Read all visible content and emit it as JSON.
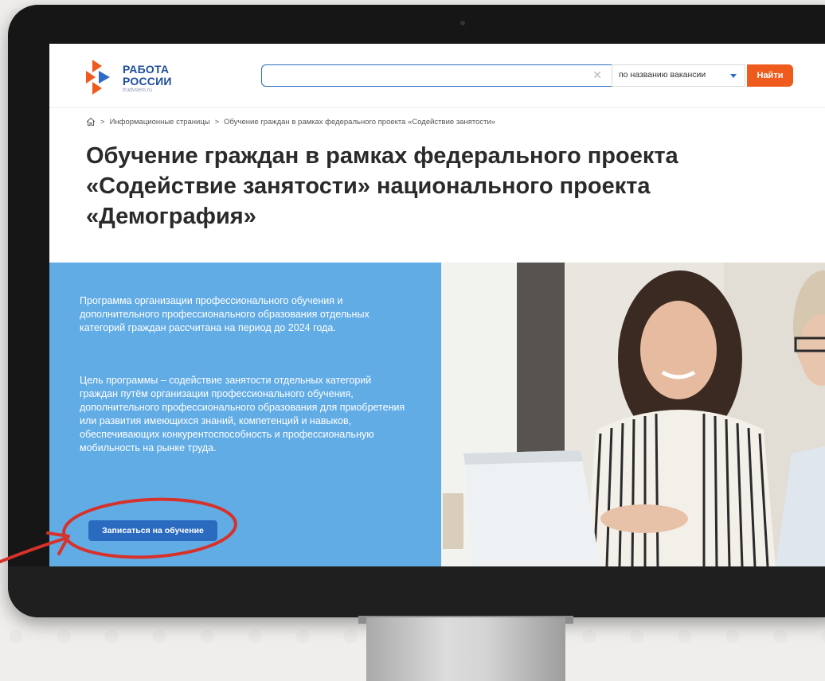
{
  "header": {
    "logo_line1": "РАБОТА",
    "logo_line2": "РОССИИ",
    "logo_site": "trudvsem.ru",
    "search_placeholder": "",
    "search_type": "по названию вакансии",
    "find_label": "Найти"
  },
  "breadcrumb": {
    "separator": ">",
    "items": [
      "Информационные страницы",
      "Обучение граждан в рамках федерального проекта «Содействие занятости»"
    ]
  },
  "page": {
    "title": "Обучение граждан в рамках федерального проекта «Содействие занятости» национального проекта «Демография»"
  },
  "panel": {
    "paragraph1": "Программа организации профессионального обучения и дополнительного профессионального образования отдельных категорий граждан рассчитана на период до 2024 года.",
    "paragraph2": "Цель программы – содействие занятости отдельных категорий граждан путём организации профессионального обучения, дополнительного профессионального образования для приобретения или развития имеющихся знаний, компетенций и навыков, обеспечивающих конкурентоспособность и профессиональную мобильность на рынке труда.",
    "enroll_label": "Записаться на обучение"
  },
  "colors": {
    "brand_blue": "#1f4e9e",
    "accent_orange": "#ef5b1d",
    "panel_blue": "#62ace6",
    "button_blue": "#2a6bc0",
    "annotation_red": "#d6322b"
  }
}
